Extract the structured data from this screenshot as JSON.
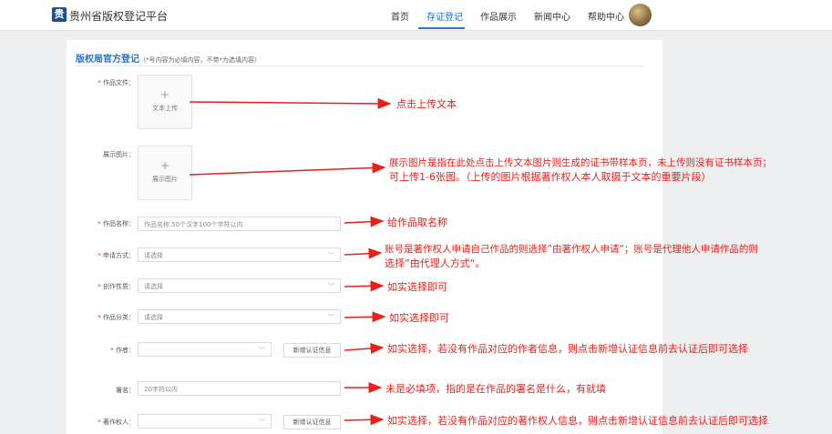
{
  "header": {
    "logo_char": "贵",
    "site_title": "贵州省版权登记平台",
    "nav": [
      "首页",
      "存证登记",
      "作品展示",
      "新闻中心",
      "帮助中心"
    ],
    "active_nav": "存证登记"
  },
  "form": {
    "heading": "版权局官方登记",
    "heading_note": "（*号内容为必填内容，不带*为选填内容）",
    "work_file_label": "作品文件：",
    "upload_text_label": "文本上传",
    "display_image_label": "展示图片：",
    "upload_image_label": "展示图片",
    "plus": "+",
    "work_name_label": "作品名称：",
    "work_name_placeholder": "作品名称,50个汉字100个字符以内",
    "apply_method_label": "申请方式：",
    "apply_method_value": "请选择",
    "creation_nature_label": "创作性质：",
    "creation_nature_value": "请选择",
    "work_category_label": "作品分类：",
    "work_category_value": "请选择",
    "author_label": "作者：",
    "add_cert_label": "新增认证信息",
    "signature_label": "署名：",
    "signature_placeholder": "20字符以内",
    "copyright_owner_label": "著作权人：",
    "required_mark": "*",
    "chevron": "﹀"
  },
  "annotations": {
    "upload_text": "点击上传文本",
    "display_image_line1": "展示图片是指在此处点击上传文本图片则生成的证书带样本页，未上传则没有证书样本页；",
    "display_image_line2": "可上传1-6张图。（上传的图片根据著作权人本人取摄于文本的重要片段）",
    "work_name": "给作品取名称",
    "apply_method_line1": "账号是著作权人申请自己作品的则选择”由著作权人申请“；账号是代理他人申请作品的则",
    "apply_method_line2": "选择”由代理人方式“。",
    "creation_nature": "如实选择即可",
    "work_category": "如实选择即可",
    "author": "如实选择，若没有作品对应的作者信息，则点击新增认证信息前去认证后即可选择",
    "signature": "未是必填项，指的是在作品的署名是什么，有就填",
    "copyright_owner": "如实选择，若没有作品对应的著作权人信息，则点击新增认证信息前去认证后即可选择"
  },
  "colors": {
    "accent": "#2a74c9",
    "annotation_red": "#e8201c",
    "required_red": "#e0301e"
  }
}
